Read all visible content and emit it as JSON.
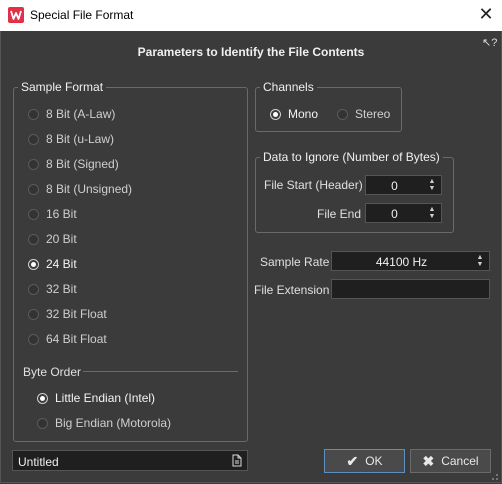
{
  "window": {
    "title": "Special File Format",
    "close_glyph": "✕"
  },
  "heading": "Parameters to Identify the File Contents",
  "sample_format": {
    "title": "Sample Format",
    "options": [
      {
        "label": "8 Bit (A-Law)",
        "selected": false
      },
      {
        "label": "8 Bit (u-Law)",
        "selected": false
      },
      {
        "label": "8 Bit (Signed)",
        "selected": false
      },
      {
        "label": "8 Bit (Unsigned)",
        "selected": false
      },
      {
        "label": "16 Bit",
        "selected": false
      },
      {
        "label": "20 Bit",
        "selected": false
      },
      {
        "label": "24 Bit",
        "selected": true
      },
      {
        "label": "32 Bit",
        "selected": false
      },
      {
        "label": "32 Bit Float",
        "selected": false
      },
      {
        "label": "64 Bit Float",
        "selected": false
      }
    ]
  },
  "byte_order": {
    "title": "Byte Order",
    "options": [
      {
        "label": "Little Endian (Intel)",
        "selected": true
      },
      {
        "label": "Big Endian (Motorola)",
        "selected": false
      }
    ]
  },
  "channels": {
    "title": "Channels",
    "options": [
      {
        "label": "Mono",
        "selected": true
      },
      {
        "label": "Stereo",
        "selected": false
      }
    ]
  },
  "ignore": {
    "title": "Data to Ignore (Number of Bytes)",
    "file_start_label": "File Start (Header)",
    "file_start_value": "0",
    "file_end_label": "File End",
    "file_end_value": "0"
  },
  "sample_rate": {
    "label": "Sample Rate",
    "value": "44100 Hz"
  },
  "file_extension": {
    "label": "File Extension",
    "value": ""
  },
  "preset": {
    "value": "Untitled"
  },
  "buttons": {
    "ok": "OK",
    "cancel": "Cancel"
  },
  "help": {
    "glyph": "↖?"
  },
  "colors": {
    "background": "#3b3b3b",
    "title_bar": "#ffffff",
    "field_bg": "#1f1f1f",
    "accent": "#5f8fbf",
    "app_icon": "#e0304a"
  }
}
